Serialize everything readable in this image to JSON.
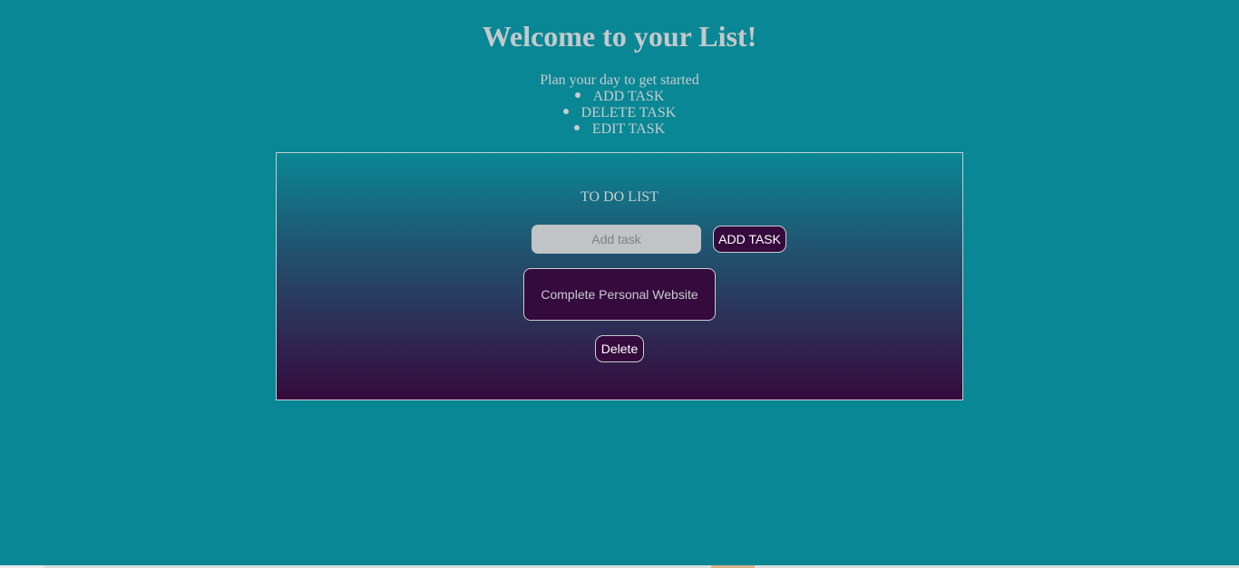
{
  "header": {
    "title": "Welcome to your List!",
    "subtitle": "Plan your day to get started",
    "features": [
      "ADD TASK",
      "DELETE TASK",
      "EDIT TASK"
    ]
  },
  "todo": {
    "heading": "TO DO LIST",
    "input_placeholder": "Add task",
    "input_value": "",
    "add_button_label": "ADD TASK",
    "tasks": [
      {
        "text": "Complete Personal Website",
        "delete_label": "Delete"
      }
    ]
  },
  "colors": {
    "page_background": "#0a8794",
    "panel_gradient_end": "#350a3c",
    "button_background": "#350a3c",
    "text_light": "#c7cdd0"
  }
}
